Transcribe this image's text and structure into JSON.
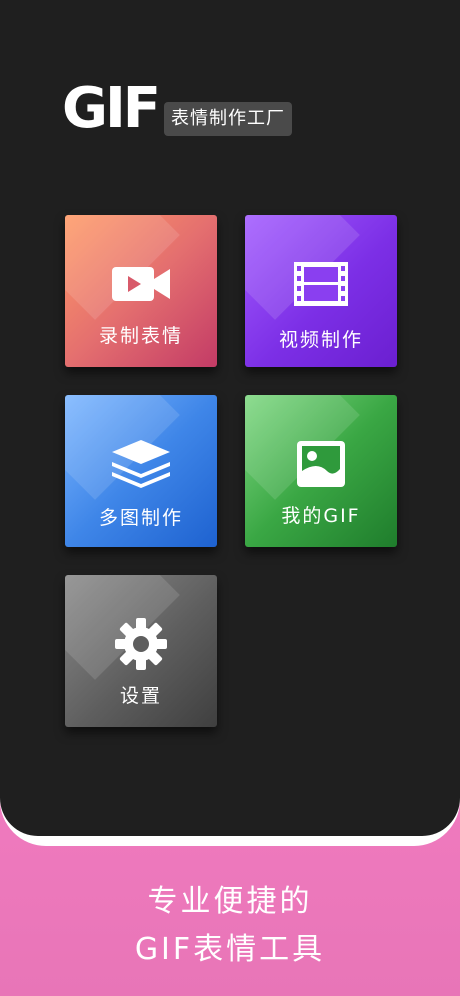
{
  "header": {
    "logo_text": "GIF",
    "badge_text": "表情制作工厂"
  },
  "tiles": [
    {
      "label": "录制表情",
      "icon": "video-camera-icon",
      "color": "#e46f6f"
    },
    {
      "label": "视频制作",
      "icon": "film-icon",
      "color": "#7c2fe6"
    },
    {
      "label": "多图制作",
      "icon": "layers-icon",
      "color": "#3f86e8"
    },
    {
      "label": "我的GIF",
      "icon": "image-icon",
      "color": "#3aa744"
    },
    {
      "label": "设置",
      "icon": "gear-icon",
      "color": "#5e5e5e"
    }
  ],
  "promo": {
    "line1": "专业便捷的",
    "line2": "GIF表情工具"
  },
  "colors": {
    "screen_bg": "#1f1f1f",
    "page_bg": "#ff86cf"
  }
}
